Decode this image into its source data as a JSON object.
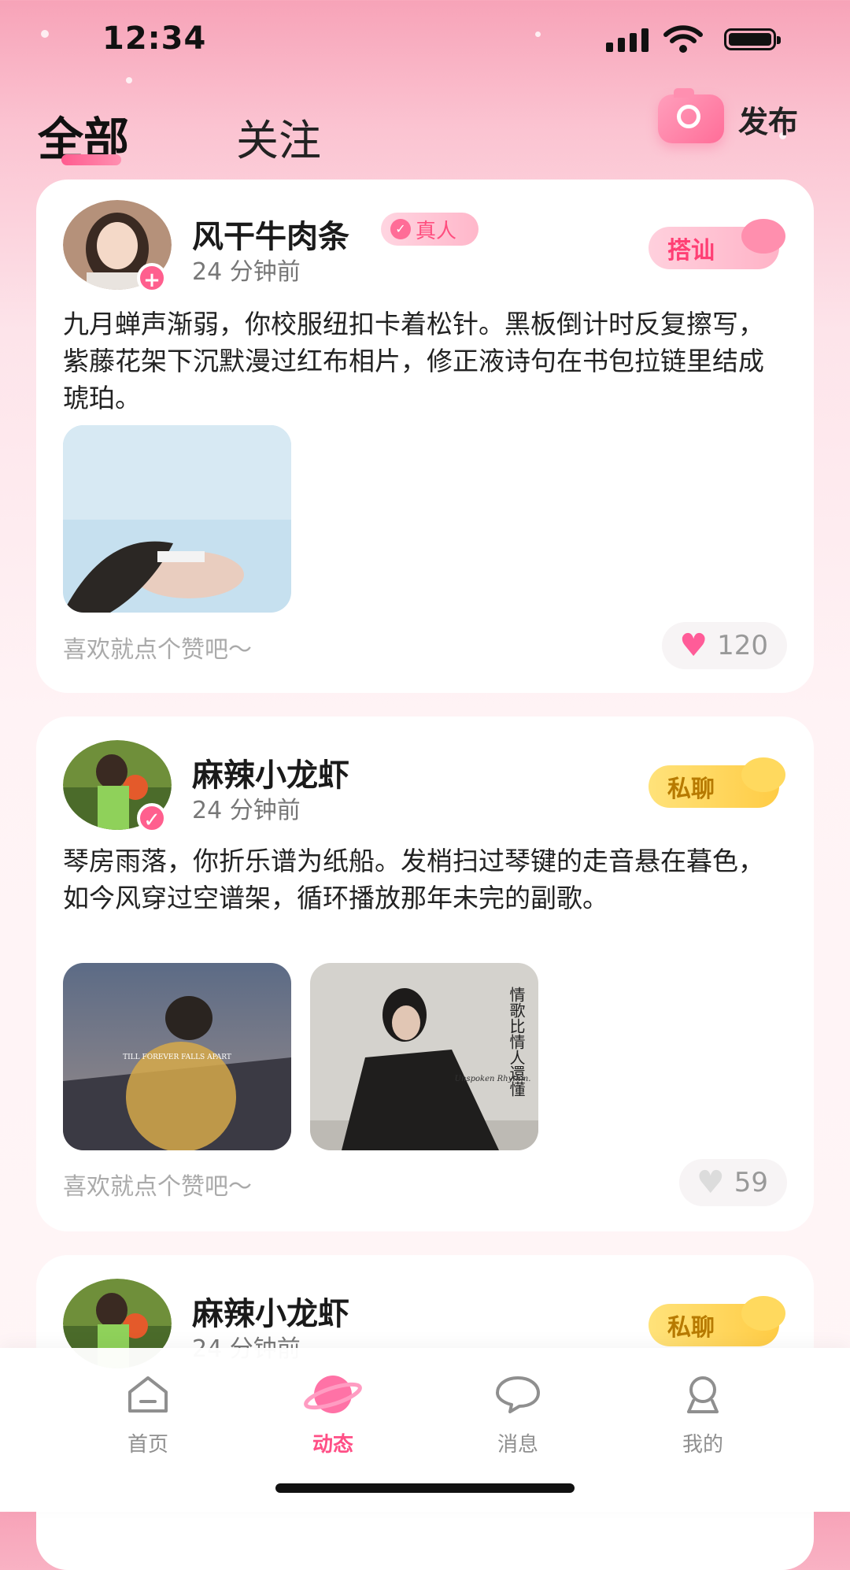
{
  "status_bar": {
    "time": "12:34"
  },
  "header": {
    "tabs": [
      {
        "label": "全部",
        "active": true
      },
      {
        "label": "关注",
        "active": false
      }
    ],
    "publish_label": "发布",
    "publish_icon": "camera-icon"
  },
  "posts": [
    {
      "name": "风干牛肉条",
      "verified_label": "真人",
      "time_ago": "24 分钟前",
      "action_label": "搭讪",
      "content": "九月蝉声渐弱，你校服纽扣卡着松针。黑板倒计时反复擦写，紫藤花架下沉默漫过红布相片，修正液诗句在书包拉链里结成琥珀。",
      "image_count": 1,
      "hint": "喜欢就点个赞吧～",
      "likes": "120",
      "liked": true
    },
    {
      "name": "麻辣小龙虾",
      "time_ago": "24 分钟前",
      "action_label": "私聊",
      "content": "琴房雨落，你折乐谱为纸船。发梢扫过琴键的走音悬在暮色，如今风穿过空谱架，循环播放那年未完的副歌。",
      "image_count": 2,
      "images": [
        {
          "caption": "TILL FOREVER FALLS APART"
        },
        {
          "caption": "情歌比情人還懂",
          "subcaption": "Unspoken Rhythm."
        }
      ],
      "hint": "喜欢就点个赞吧～",
      "likes": "59",
      "liked": false
    },
    {
      "name": "麻辣小龙虾",
      "time_ago": "24 分钟前",
      "action_label": "私聊"
    }
  ],
  "nav": [
    {
      "label": "首页",
      "icon": "home-icon",
      "active": false
    },
    {
      "label": "动态",
      "icon": "planet-icon",
      "active": true
    },
    {
      "label": "消息",
      "icon": "message-icon",
      "active": false
    },
    {
      "label": "我的",
      "icon": "profile-icon",
      "active": false
    }
  ],
  "colors": {
    "accent": "#ff4f86",
    "gold": "#ffcc45",
    "background": "#fde4ea"
  }
}
